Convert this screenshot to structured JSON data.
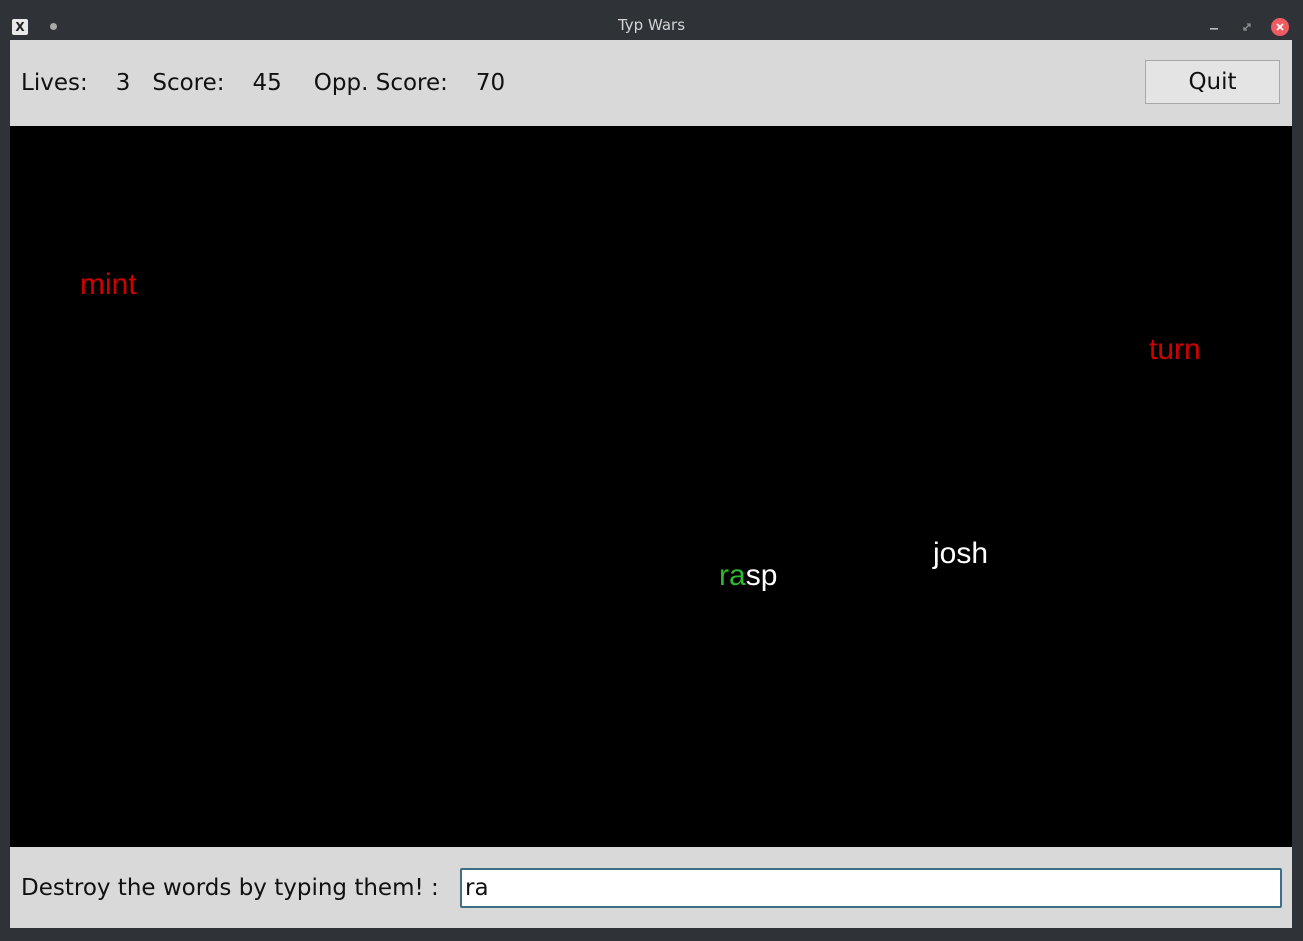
{
  "window": {
    "title": "Typ Wars",
    "app_icon_glyph": "X",
    "controls": {
      "minimize_icon": "minimize-icon",
      "maximize_icon": "restore-icon",
      "close_icon": "close-icon"
    }
  },
  "status": {
    "lives_label": "Lives:",
    "lives_value": "3",
    "score_label": "Score:",
    "score_value": "45",
    "opp_score_label": "Opp. Score:",
    "opp_score_value": "70",
    "quit_label": "Quit"
  },
  "game": {
    "background": "#000000",
    "words": [
      {
        "text": "mint",
        "color": "red"
      },
      {
        "text": "turn",
        "color": "red"
      },
      {
        "text": "josh",
        "color": "white"
      },
      {
        "typed": "ra",
        "rest": "sp",
        "full": "rasp"
      }
    ],
    "colors": {
      "enemy": "#d00000",
      "neutral": "#ffffff",
      "typed": "#2db82d"
    }
  },
  "input": {
    "prompt": "Destroy the words by typing them! :",
    "value": "ra"
  }
}
